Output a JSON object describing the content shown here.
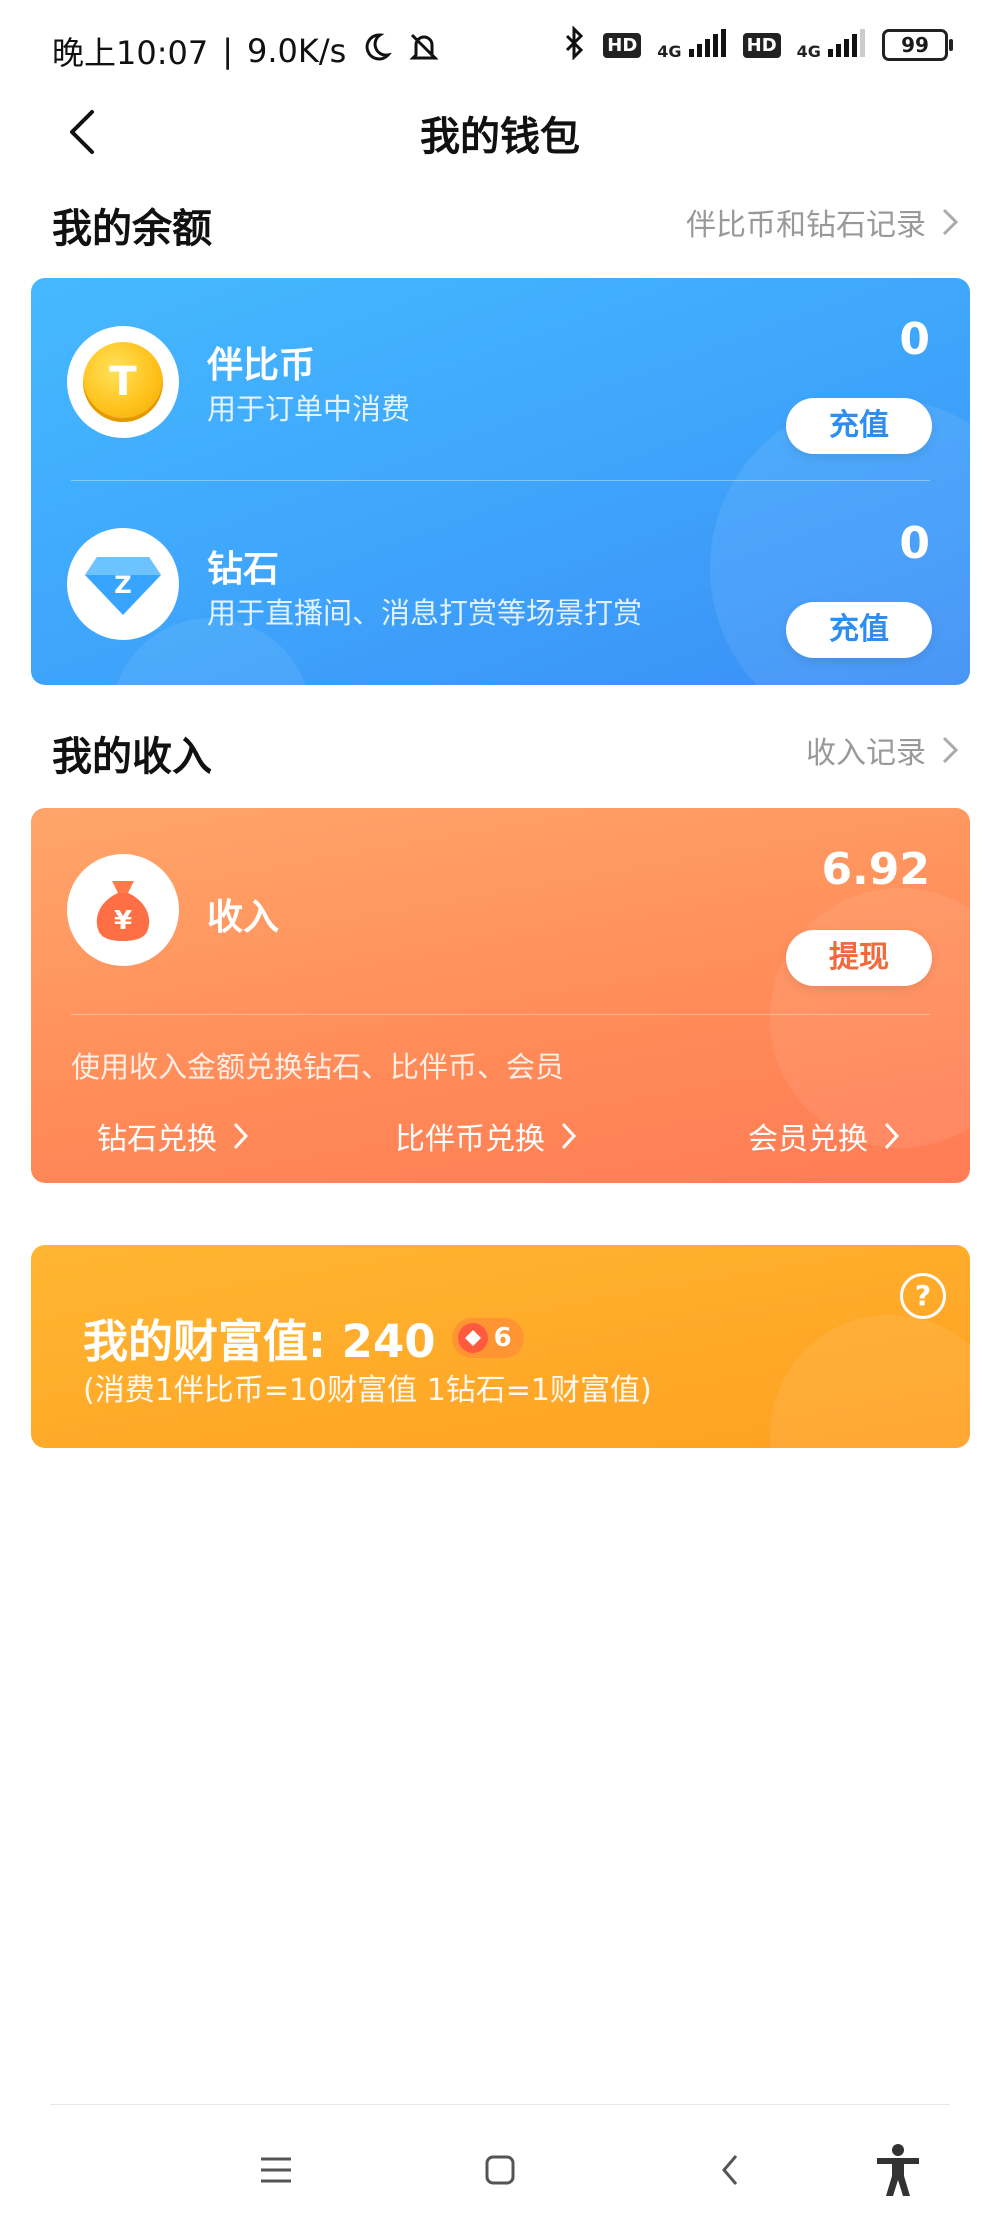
{
  "status_bar": {
    "time": "晚上10:07",
    "speed": "9.0K/s",
    "hd1": "HD",
    "sig1": "4G",
    "hd2": "HD",
    "sig2": "4G",
    "battery": "99"
  },
  "header": {
    "title": "我的钱包"
  },
  "balance": {
    "section_title": "我的余额",
    "record_link": "伴比币和钻石记录",
    "items": [
      {
        "name": "伴比币",
        "desc": "用于订单中消费",
        "amount": "0",
        "button": "充值",
        "icon": "coin-icon",
        "icon_text": "T"
      },
      {
        "name": "钻石",
        "desc": "用于直播间、消息打赏等场景打赏",
        "amount": "0",
        "button": "充值",
        "icon": "diamond-icon",
        "icon_text": "Z"
      }
    ]
  },
  "income": {
    "section_title": "我的收入",
    "record_link": "收入记录",
    "name": "收入",
    "amount": "6.92",
    "button": "提现",
    "icon": "money-bag-icon",
    "exchange_note": "使用收入金额兑换钻石、比伴币、会员",
    "exchanges": [
      "钻石兑换",
      "比伴币兑换",
      "会员兑换"
    ]
  },
  "wealth": {
    "label": "我的财富值: 240",
    "level": "6",
    "note": "(消费1伴比币=10财富值 1钻石=1财富值)",
    "help": "?"
  },
  "colors": {
    "blue_card": "#3ea4fb",
    "orange_card": "#ff8b58",
    "yellow_card": "#ffa022"
  }
}
